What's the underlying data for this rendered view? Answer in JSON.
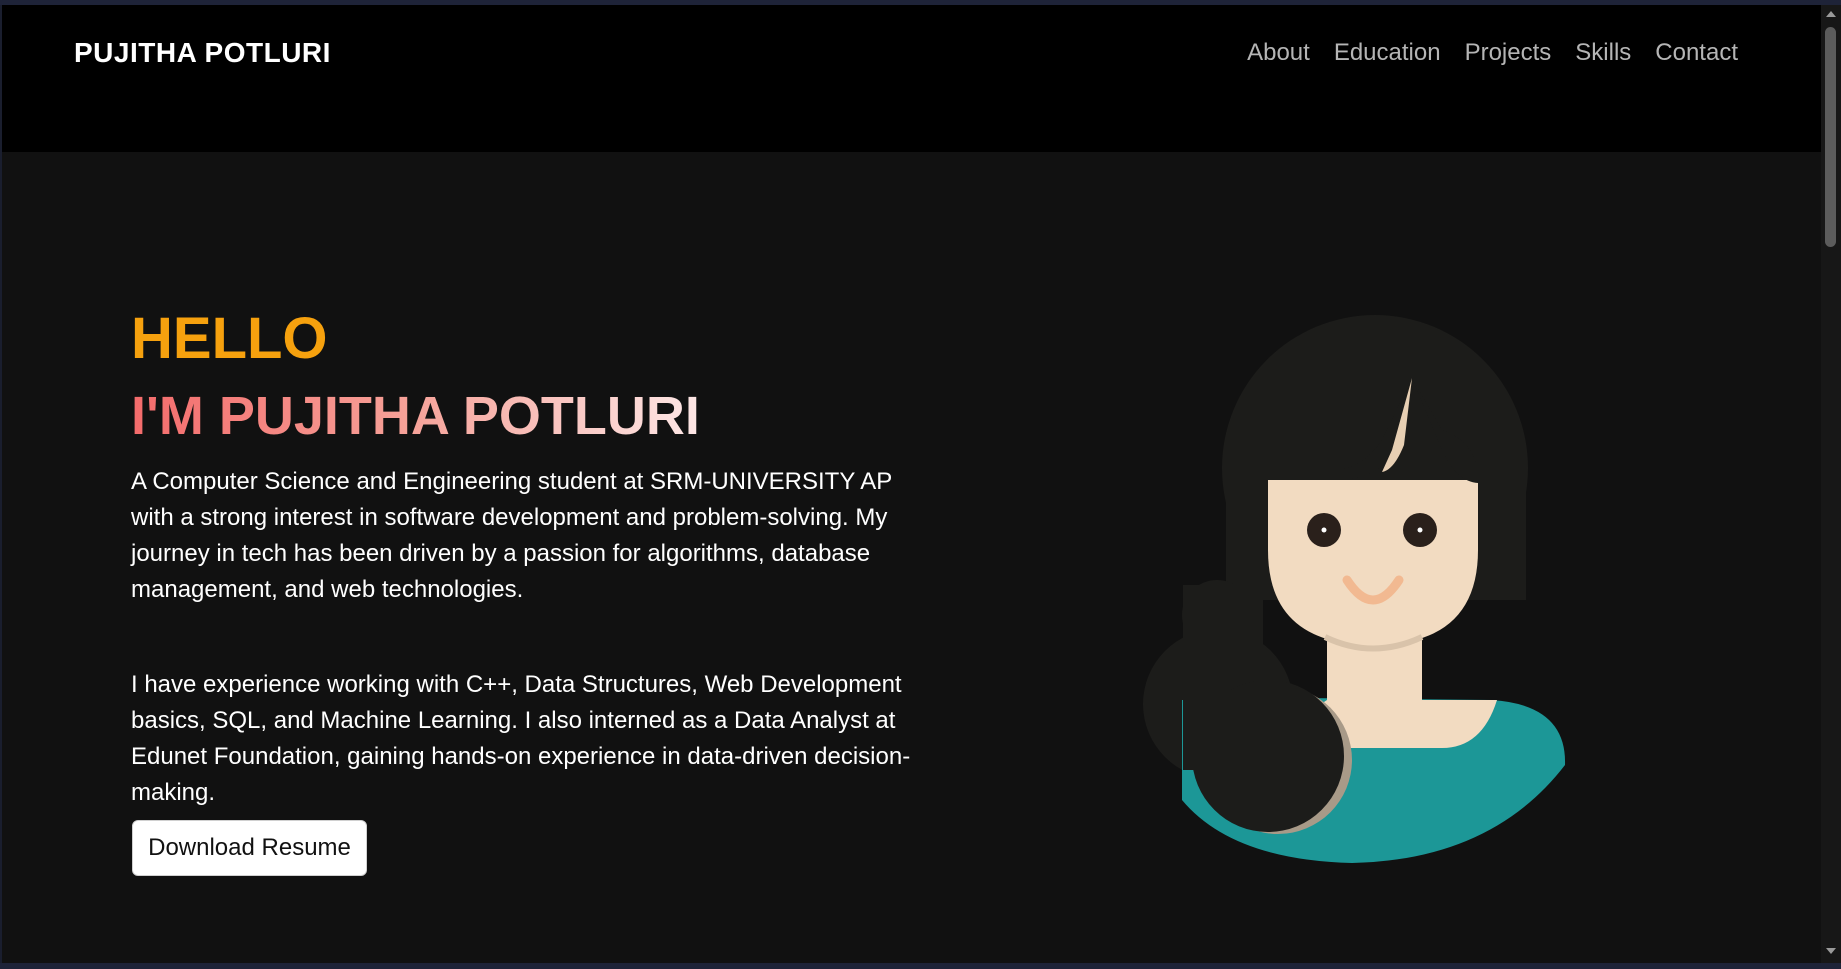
{
  "header": {
    "brand": "PUJITHA POTLURI",
    "nav": [
      {
        "label": "About"
      },
      {
        "label": "Education"
      },
      {
        "label": "Projects"
      },
      {
        "label": "Skills"
      },
      {
        "label": "Contact"
      }
    ]
  },
  "hero": {
    "greeting": "HELLO",
    "name_line": "I'M PUJITHA POTLURI",
    "paragraph1": "A Computer Science and Engineering student at SRM-UNIVERSITY AP with a strong interest in software development and problem-solving. My journey in tech has been driven by a passion for algorithms, database management, and web technologies.",
    "paragraph2": "I have experience working with C++, Data Structures, Web Development basics, SQL, and Machine Learning. I also interned as a Data Analyst at Edunet Foundation, gaining hands-on experience in data-driven decision-making.",
    "resume_button": "Download Resume",
    "avatar_icon": "girl-avatar-illustration"
  },
  "colors": {
    "navbar_bg": "#000000",
    "page_bg": "#111111",
    "greeting": "#f6a10e",
    "name_gradient_start": "#f46b6b",
    "name_gradient_end": "#fde7e6",
    "hair": "#1c1c1a",
    "skin": "#f2dbc1",
    "shirt": "#1c9797"
  }
}
